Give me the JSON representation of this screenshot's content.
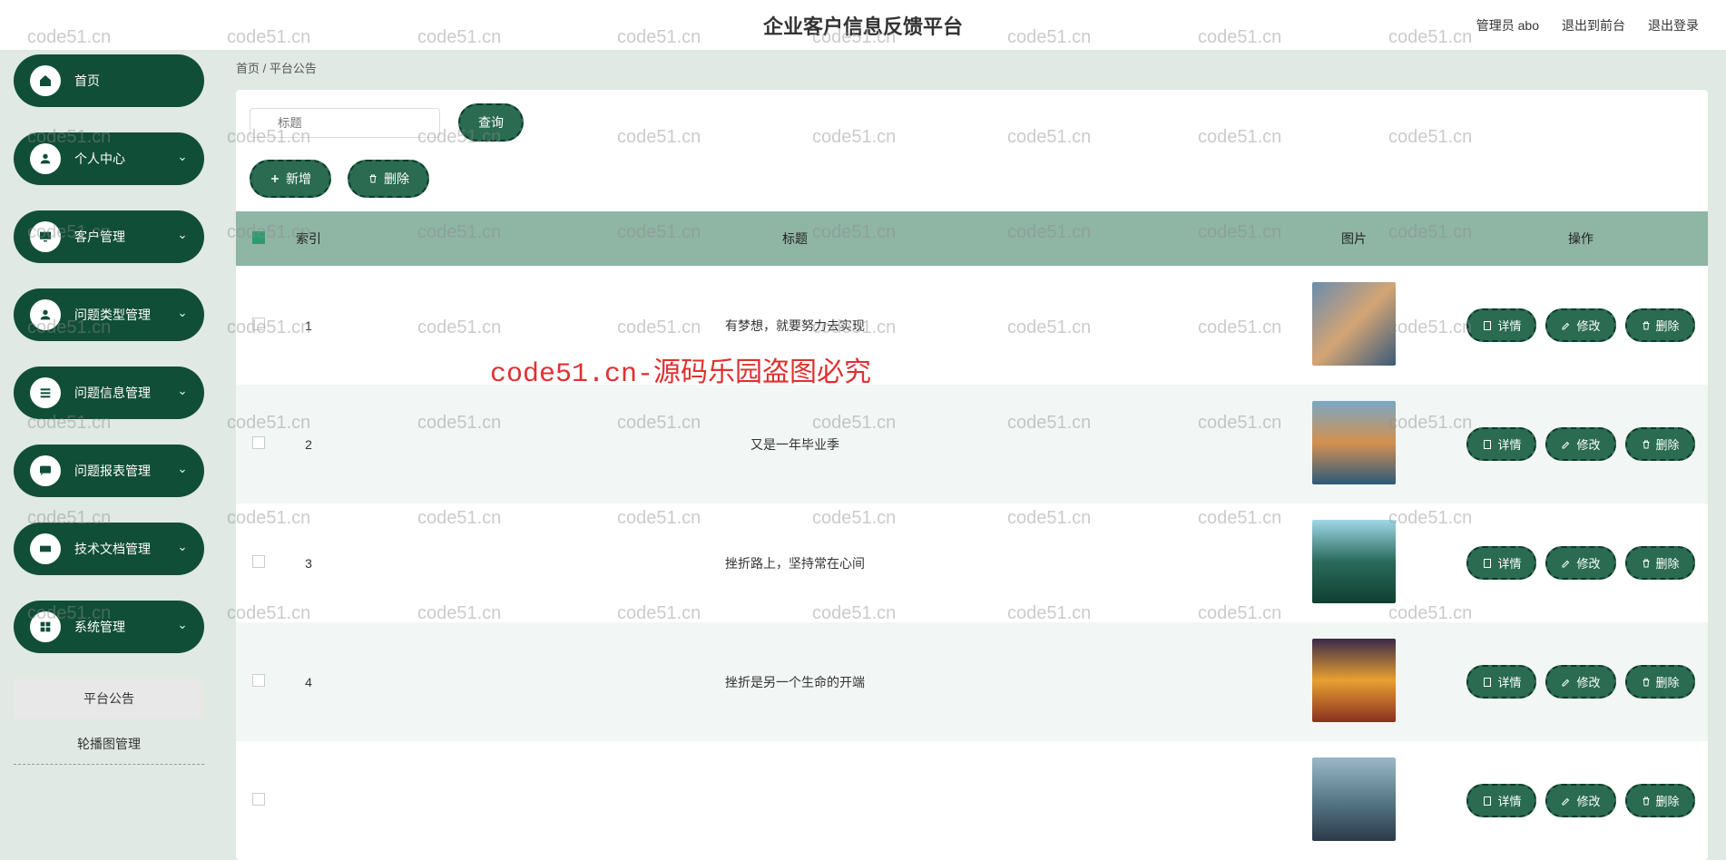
{
  "header": {
    "title": "企业客户信息反馈平台",
    "admin_label": "管理员 abo",
    "front_label": "退出到前台",
    "logout_label": "退出登录"
  },
  "sidebar": {
    "items": [
      {
        "label": "首页",
        "icon": "home",
        "expandable": false
      },
      {
        "label": "个人中心",
        "icon": "user",
        "expandable": true
      },
      {
        "label": "客户管理",
        "icon": "monitor",
        "expandable": true
      },
      {
        "label": "问题类型管理",
        "icon": "user",
        "expandable": true
      },
      {
        "label": "问题信息管理",
        "icon": "bars",
        "expandable": true
      },
      {
        "label": "问题报表管理",
        "icon": "chat",
        "expandable": true
      },
      {
        "label": "技术文档管理",
        "icon": "ticket",
        "expandable": true
      },
      {
        "label": "系统管理",
        "icon": "grid",
        "expandable": true
      }
    ],
    "sub_items": [
      {
        "label": "平台公告",
        "active": true
      },
      {
        "label": "轮播图管理",
        "active": false
      }
    ]
  },
  "breadcrumb": {
    "home": "首页",
    "sep": "/",
    "current": "平台公告"
  },
  "toolbar": {
    "search_placeholder": "标题",
    "query_label": "查询",
    "add_label": "新增",
    "delete_label": "删除"
  },
  "table": {
    "headers": {
      "index": "索引",
      "title": "标题",
      "image": "图片",
      "actions": "操作"
    },
    "action_labels": {
      "detail": "详情",
      "edit": "修改",
      "delete": "删除"
    },
    "rows": [
      {
        "index": "1",
        "title": "有梦想，就要努力去实现",
        "thumb": "t1"
      },
      {
        "index": "2",
        "title": "又是一年毕业季",
        "thumb": "t2"
      },
      {
        "index": "3",
        "title": "挫折路上，坚持常在心间",
        "thumb": "t3"
      },
      {
        "index": "4",
        "title": "挫折是另一个生命的开端",
        "thumb": "t4"
      },
      {
        "index": "",
        "title": "",
        "thumb": "t5"
      }
    ]
  },
  "watermark": {
    "text": "code51.cn",
    "red": "code51.cn-源码乐园盗图必究"
  }
}
